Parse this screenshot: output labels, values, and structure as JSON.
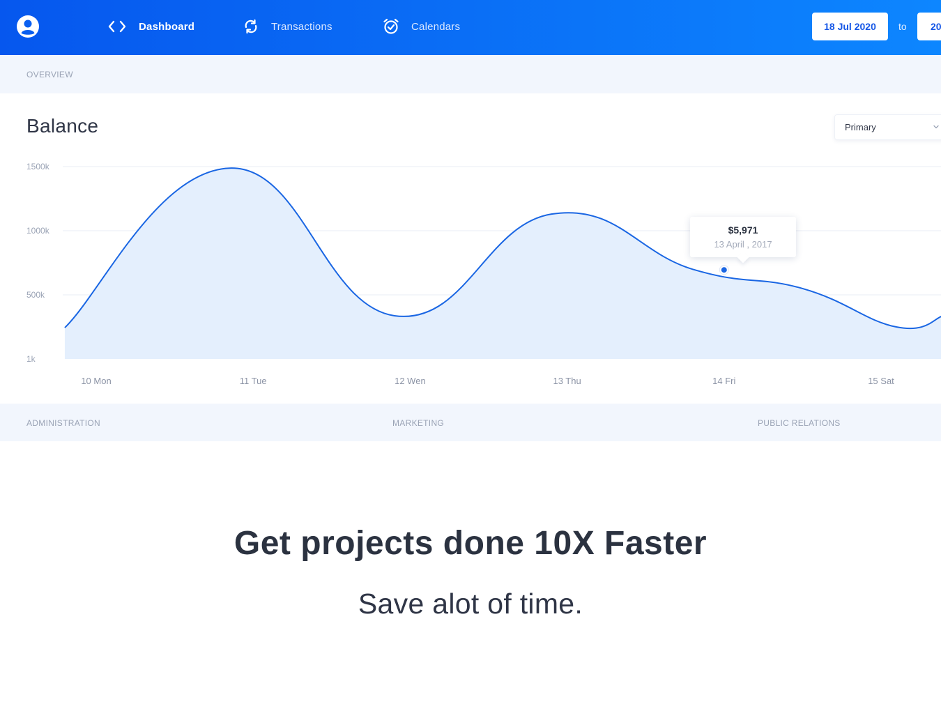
{
  "nav": {
    "items": [
      {
        "label": "Dashboard",
        "icon": "code-brackets-icon"
      },
      {
        "label": "Transactions",
        "icon": "refresh-icon"
      },
      {
        "label": "Calendars",
        "icon": "alarm-clock-icon"
      }
    ],
    "date_from": "18 Jul 2020",
    "to_label": "to",
    "date_to": "20"
  },
  "overview": {
    "label": "OVERVIEW"
  },
  "balance": {
    "title": "Balance",
    "select_value": "Primary",
    "tooltip": {
      "value": "$5,971",
      "date": "13 April , 2017"
    }
  },
  "chart_data": {
    "type": "area",
    "title": "Balance",
    "categories": [
      "10 Mon",
      "11 Tue",
      "12 Wen",
      "13 Thu",
      "14 Fri",
      "15 Sat"
    ],
    "y_ticks": [
      "1500k",
      "1000k",
      "500k",
      "1k"
    ],
    "ylim": [
      1,
      1500
    ],
    "series": [
      {
        "x": [
          -0.2,
          0.85,
          1.9,
          2.9,
          3.8,
          4.5,
          5.1,
          5.4
        ],
        "values": [
          245,
          1488,
          338,
          1130,
          700,
          550,
          250,
          340
        ]
      }
    ],
    "highlight": {
      "x": 4.0,
      "value": 695
    },
    "grid": true,
    "colors": {
      "line": "#1a66e3",
      "fill": "#e4effd",
      "point": "#1a66e3"
    }
  },
  "departments": [
    "ADMINISTRATION",
    "MARKETING",
    "PUBLIC RELATIONS"
  ],
  "hero": {
    "title": "Get projects done 10X Faster",
    "subtitle": "Save alot of time."
  }
}
